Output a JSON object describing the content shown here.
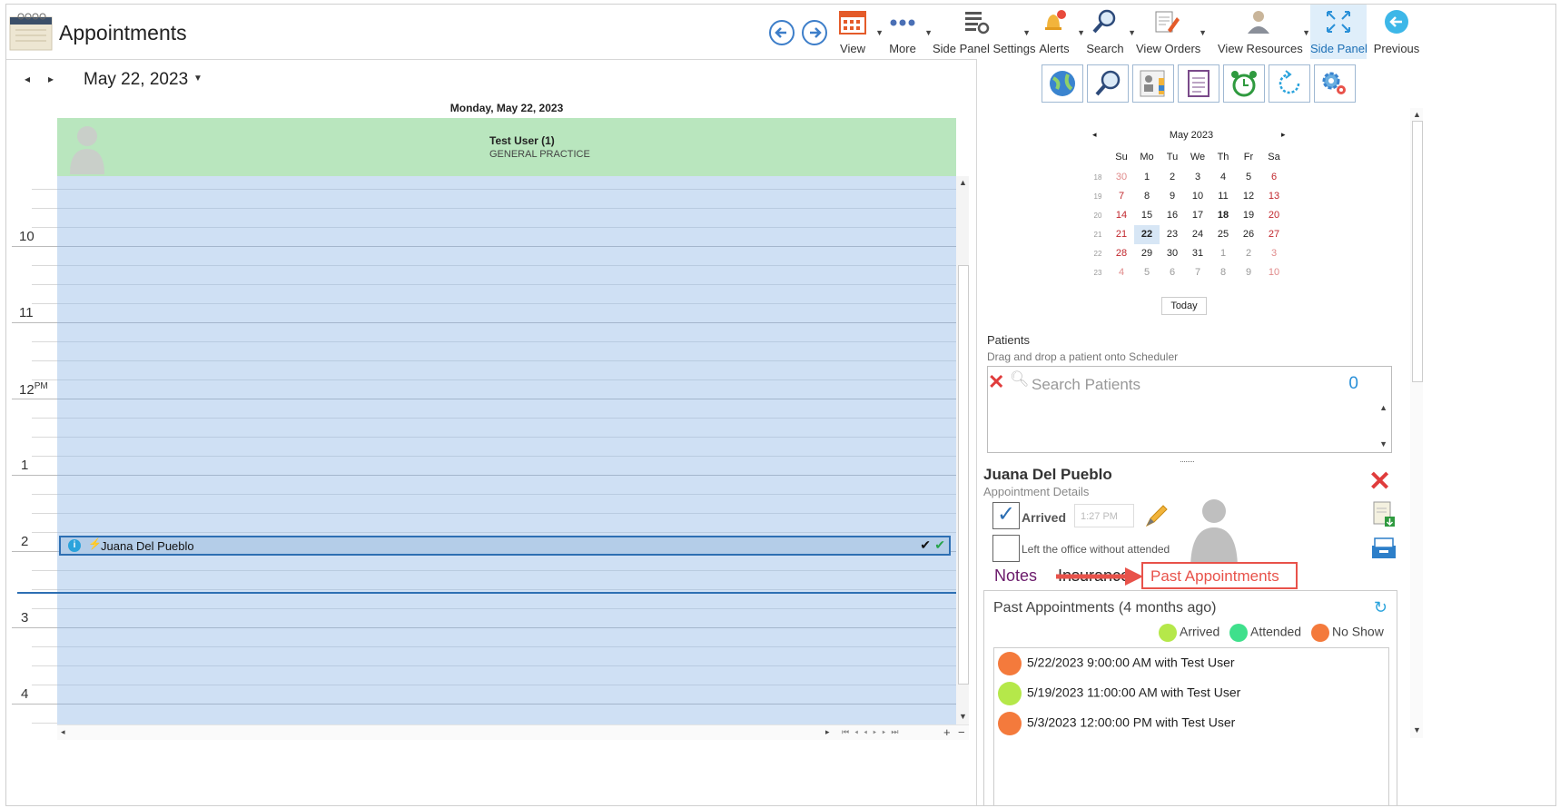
{
  "app": {
    "title": "Appointments"
  },
  "toolbar": {
    "view": "View",
    "more": "More",
    "side_panel_settings": "Side Panel Settings",
    "alerts": "Alerts",
    "search": "Search",
    "view_orders": "View Orders",
    "view_resources": "View Resources",
    "side_panel": "Side Panel",
    "previous": "Previous"
  },
  "scheduler": {
    "date": "May 22, 2023",
    "day_header": "Monday, May 22, 2023",
    "resource": {
      "name": "Test User (1)",
      "specialty": "GENERAL PRACTICE"
    },
    "hours": [
      "10",
      "11",
      "12",
      "1",
      "2",
      "3",
      "4"
    ],
    "pm_label": "PM",
    "appointment": {
      "patient": "Juana Del Pueblo"
    }
  },
  "mini_calendar": {
    "month": "May 2023",
    "weekdays": [
      "Su",
      "Mo",
      "Tu",
      "We",
      "Th",
      "Fr",
      "Sa"
    ],
    "weeks": [
      {
        "wk": "18",
        "days": [
          "30",
          "1",
          "2",
          "3",
          "4",
          "5",
          "6"
        ]
      },
      {
        "wk": "19",
        "days": [
          "7",
          "8",
          "9",
          "10",
          "11",
          "12",
          "13"
        ]
      },
      {
        "wk": "20",
        "days": [
          "14",
          "15",
          "16",
          "17",
          "18",
          "19",
          "20"
        ]
      },
      {
        "wk": "21",
        "days": [
          "21",
          "22",
          "23",
          "24",
          "25",
          "26",
          "27"
        ]
      },
      {
        "wk": "22",
        "days": [
          "28",
          "29",
          "30",
          "31",
          "1",
          "2",
          "3"
        ]
      },
      {
        "wk": "23",
        "days": [
          "4",
          "5",
          "6",
          "7",
          "8",
          "9",
          "10"
        ]
      }
    ],
    "today_button": "Today"
  },
  "patients": {
    "title": "Patients",
    "subtitle": "Drag and drop a patient onto Scheduler",
    "search_placeholder": "Search Patients",
    "count": "0"
  },
  "appointment_details": {
    "patient_name": "Juana Del Pueblo",
    "subtitle": "Appointment Details",
    "arrived_label": "Arrived",
    "arrived_time": "1:27 PM",
    "left_label": "Left the office without attended"
  },
  "tabs": {
    "notes": "Notes",
    "insurance": "Insurance",
    "callout": "Past Appointments"
  },
  "past_appointments": {
    "title": "Past Appointments (4 months ago)",
    "legend": [
      {
        "label": "Arrived",
        "color": "#b5e84a"
      },
      {
        "label": "Attended",
        "color": "#3fe08c"
      },
      {
        "label": "No Show",
        "color": "#f47a3c"
      }
    ],
    "items": [
      {
        "text": "5/22/2023 9:00:00 AM with Test User",
        "color": "#f47a3c"
      },
      {
        "text": "5/19/2023 11:00:00 AM with Test User",
        "color": "#b5e84a"
      },
      {
        "text": "5/3/2023 12:00:00 PM with Test User",
        "color": "#f47a3c"
      }
    ]
  },
  "colors": {
    "accent": "#2d6fb3",
    "resource_header": "#b9e6be",
    "grid": "#cfe0f4",
    "callout": "#e8524a"
  }
}
